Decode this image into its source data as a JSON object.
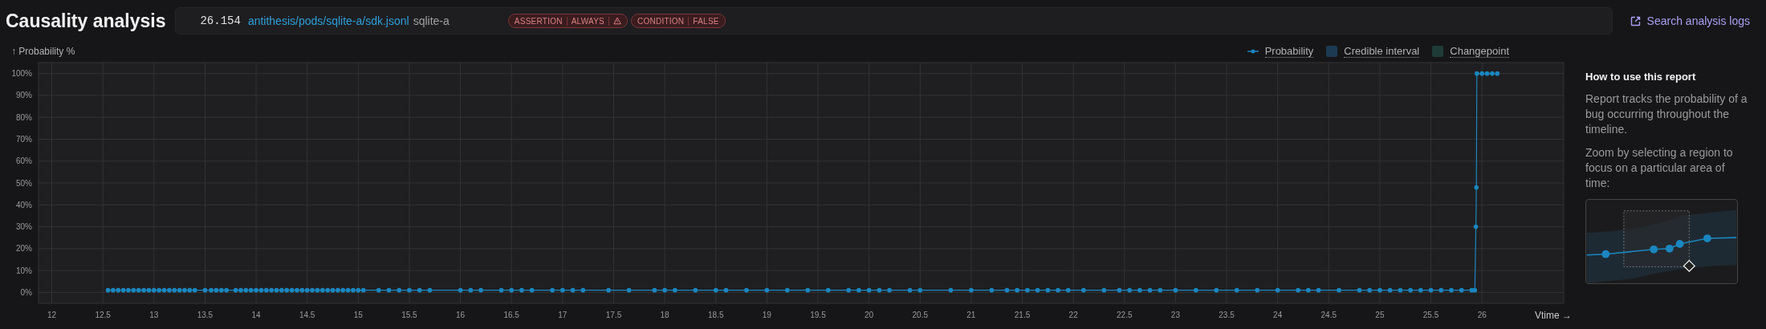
{
  "header": {
    "title": "Causality analysis",
    "source": {
      "time": "26.154",
      "path": "antithesis/pods/sqlite-a/sdk.jsonl",
      "name": "sqlite-a"
    },
    "badges": [
      {
        "parts": [
          "ASSERTION",
          "ALWAYS"
        ],
        "warning": true
      },
      {
        "parts": [
          "CONDITION",
          "FALSE"
        ],
        "warning": false
      }
    ],
    "search_link": "Search analysis logs"
  },
  "legend": [
    {
      "kind": "line",
      "color": "#1a86c0"
    },
    {
      "label": "Credible interval",
      "kind": "swatch",
      "color": "#1d3a52"
    },
    {
      "label": "Changepoint",
      "kind": "swatch",
      "color": "#1f3b38"
    }
  ],
  "chart_data": {
    "type": "line",
    "grid": true,
    "xlabel": "Vtime →",
    "ylabel": "↑ Probability %",
    "xlim": [
      11.87,
      26.8
    ],
    "ylim": [
      -5,
      105
    ],
    "xticks": [
      12,
      12.5,
      13,
      13.5,
      14,
      14.5,
      15,
      15.5,
      16,
      16.5,
      17,
      17.5,
      18,
      18.5,
      19,
      19.5,
      20,
      20.5,
      21,
      21.5,
      22,
      22.5,
      23,
      23.5,
      24,
      24.5,
      25,
      25.5,
      26
    ],
    "yticks": [
      {
        "value": 0,
        "label": "0%"
      },
      {
        "value": 10,
        "label": "10%"
      },
      {
        "value": 20,
        "label": "20%"
      },
      {
        "value": 30,
        "label": "30%"
      },
      {
        "value": 40,
        "label": "40%"
      },
      {
        "value": 50,
        "label": "50%"
      },
      {
        "value": 60,
        "label": "60%"
      },
      {
        "value": 70,
        "label": "70%"
      },
      {
        "value": 80,
        "label": "80%"
      },
      {
        "value": 90,
        "label": "90%"
      },
      {
        "value": 100,
        "label": "100%"
      }
    ],
    "x": [
      12.55,
      12.6,
      12.65,
      12.7,
      12.75,
      12.8,
      12.85,
      12.9,
      12.95,
      13.0,
      13.05,
      13.1,
      13.15,
      13.2,
      13.25,
      13.3,
      13.35,
      13.4,
      13.5,
      13.56,
      13.61,
      13.66,
      13.71,
      13.8,
      13.85,
      13.9,
      13.95,
      14.0,
      14.05,
      14.1,
      14.15,
      14.2,
      14.25,
      14.3,
      14.35,
      14.4,
      14.45,
      14.5,
      14.55,
      14.6,
      14.65,
      14.7,
      14.75,
      14.8,
      14.85,
      14.9,
      14.95,
      15.0,
      15.05,
      15.2,
      15.3,
      15.4,
      15.5,
      15.6,
      15.7,
      16.0,
      16.1,
      16.2,
      16.4,
      16.5,
      16.6,
      16.7,
      16.9,
      17.0,
      17.1,
      17.2,
      17.45,
      17.65,
      17.9,
      18.0,
      18.1,
      18.3,
      18.5,
      18.6,
      18.8,
      19.0,
      19.2,
      19.4,
      19.6,
      19.8,
      19.9,
      20.0,
      20.1,
      20.2,
      20.4,
      20.5,
      20.8,
      21.0,
      21.2,
      21.35,
      21.45,
      21.55,
      21.65,
      21.75,
      21.85,
      21.95,
      22.1,
      22.3,
      22.45,
      22.55,
      22.65,
      22.75,
      22.85,
      23.0,
      23.2,
      23.4,
      23.6,
      23.8,
      24.0,
      24.2,
      24.3,
      24.4,
      24.6,
      24.8,
      24.9,
      25.0,
      25.1,
      25.2,
      25.3,
      25.4,
      25.5,
      25.6,
      25.7,
      25.8,
      25.9,
      25.93,
      25.94,
      25.945,
      25.95,
      26.0,
      26.05,
      26.1,
      26.15
    ],
    "series": [
      {
        "name": "Probability",
        "color": "#1a86c0",
        "values": [
          1,
          1,
          1,
          1,
          1,
          1,
          1,
          1,
          1,
          1,
          1,
          1,
          1,
          1,
          1,
          1,
          1,
          1,
          1,
          1,
          1,
          1,
          1,
          1,
          1,
          1,
          1,
          1,
          1,
          1,
          1,
          1,
          1,
          1,
          1,
          1,
          1,
          1,
          1,
          1,
          1,
          1,
          1,
          1,
          1,
          1,
          1,
          1,
          1,
          1,
          1,
          1,
          1,
          1,
          1,
          1,
          1,
          1,
          1,
          1,
          1,
          1,
          1,
          1,
          1,
          1,
          1,
          1,
          1,
          1,
          1,
          1,
          1,
          1,
          1,
          1,
          1,
          1,
          1,
          1,
          1,
          1,
          1,
          1,
          1,
          1,
          1,
          1,
          1,
          1,
          1,
          1,
          1,
          1,
          1,
          1,
          1,
          1,
          1,
          1,
          1,
          1,
          1,
          1,
          1,
          1,
          1,
          1,
          1,
          1,
          1,
          1,
          1,
          1,
          1,
          1,
          1,
          1,
          1,
          1,
          1,
          1,
          1,
          1,
          1,
          1,
          30,
          48,
          100,
          100,
          100,
          100,
          100
        ]
      }
    ]
  },
  "help": {
    "title": "How to use this report",
    "paragraphs": [
      "Report tracks the probability of a bug occurring throughout the timeline.",
      "Zoom by selecting a region to focus on a particular area of time:"
    ]
  }
}
